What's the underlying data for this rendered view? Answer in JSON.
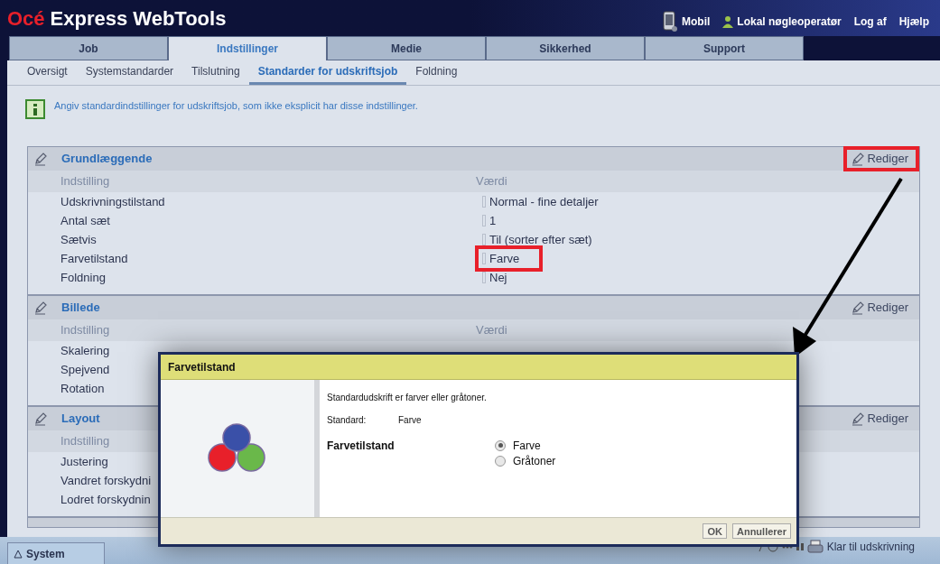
{
  "header": {
    "logo_brand": "Océ",
    "logo_product": "Express WebTools",
    "links": [
      {
        "label": "Mobil",
        "kind": "mobile"
      },
      {
        "label": "Lokal nøgleoperatør",
        "kind": "user"
      },
      {
        "label": "Log af",
        "kind": "plain"
      },
      {
        "label": "Hjælp",
        "kind": "plain"
      }
    ]
  },
  "tabs": [
    {
      "label": "Job",
      "selected": false
    },
    {
      "label": "Indstillinger",
      "selected": true
    },
    {
      "label": "Medie",
      "selected": false
    },
    {
      "label": "Sikkerhed",
      "selected": false
    },
    {
      "label": "Support",
      "selected": false
    }
  ],
  "subtabs": [
    {
      "label": "Oversigt",
      "selected": false
    },
    {
      "label": "Systemstandarder",
      "selected": false
    },
    {
      "label": "Tilslutning",
      "selected": false
    },
    {
      "label": "Standarder for udskriftsjob",
      "selected": true
    },
    {
      "label": "Foldning",
      "selected": false
    }
  ],
  "info": "Angiv standardindstillinger for udskriftsjob, som ikke eksplicit har disse indstillinger.",
  "sections": [
    {
      "title": "Grundlæggende",
      "edit": "Rediger",
      "edit_highlighted": true,
      "columns": [
        "Indstilling",
        "Værdi"
      ],
      "rows": [
        {
          "setting": "Udskrivningstilstand",
          "value": "Normal - fine detaljer",
          "highlighted": false
        },
        {
          "setting": "Antal sæt",
          "value": "1",
          "highlighted": false
        },
        {
          "setting": "Sætvis",
          "value": "Til (sorter efter sæt)",
          "highlighted": false
        },
        {
          "setting": "Farvetilstand",
          "value": "Farve",
          "highlighted": true
        },
        {
          "setting": "Foldning",
          "value": "Nej",
          "highlighted": false
        }
      ]
    },
    {
      "title": "Billede",
      "edit": "Rediger",
      "edit_highlighted": false,
      "columns": [
        "Indstilling",
        "Værdi"
      ],
      "rows": [
        {
          "setting": "Skalering"
        },
        {
          "setting": "Spejvend"
        },
        {
          "setting": "Rotation"
        }
      ]
    },
    {
      "title": "Layout",
      "edit": "Rediger",
      "edit_highlighted": false,
      "columns": [
        "Indstilling"
      ],
      "rows": [
        {
          "setting": "Justering"
        },
        {
          "setting": "Vandret forskydni"
        },
        {
          "setting": "Lodret forskydnin"
        }
      ]
    }
  ],
  "dialog": {
    "title": "Farvetilstand",
    "description": "Standardudskrift er farver eller gråtoner.",
    "default_label": "Standard:",
    "default_value": "Farve",
    "field_label": "Farvetilstand",
    "options": [
      {
        "label": "Farve",
        "selected": true
      },
      {
        "label": "Gråtoner",
        "selected": false
      }
    ],
    "buttons": [
      "OK",
      "Annullerer"
    ]
  },
  "status_bar": {
    "tab": "System",
    "status": "Klar til udskrivning"
  }
}
